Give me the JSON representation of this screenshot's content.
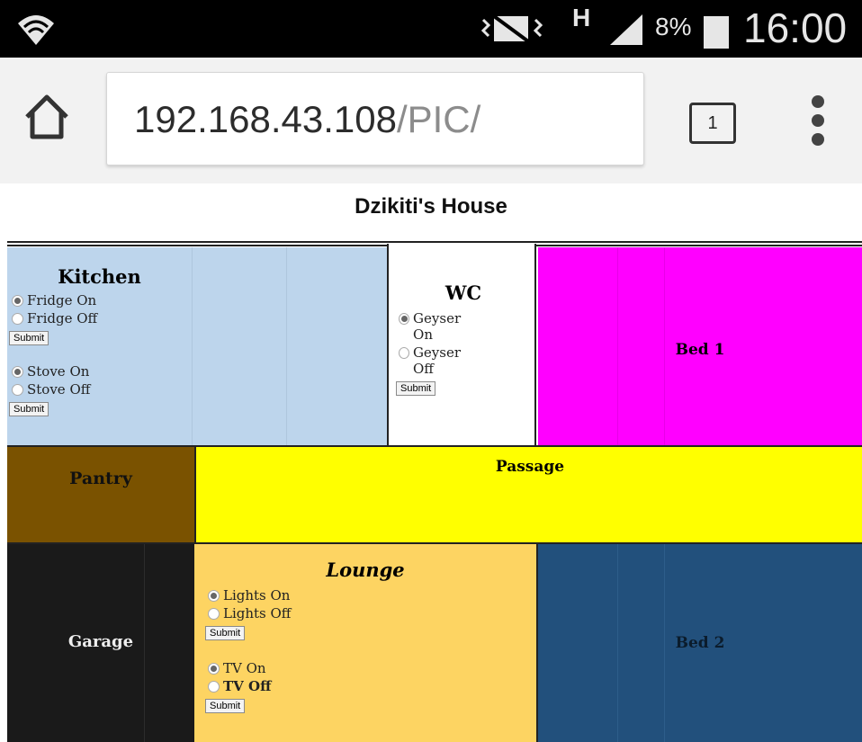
{
  "status_bar": {
    "h_indicator": "H",
    "battery_percent": "8%",
    "time": "16:00",
    "icons": [
      "wifi-icon",
      "mute-vibrate-icon",
      "data-transfer-icon",
      "signal-icon",
      "battery-icon"
    ]
  },
  "browser": {
    "url_host": "192.168.43.108",
    "url_path": "/PIC/",
    "tab_count": "1",
    "icons": [
      "home-icon",
      "tabs-icon",
      "overflow-menu-icon"
    ]
  },
  "page": {
    "title": "Dzikiti's House",
    "rooms": {
      "kitchen": {
        "name": "Kitchen",
        "color": "#bdd5ec",
        "fridge_on": "Fridge On",
        "fridge_off": "Fridge Off",
        "stove_on": "Stove On",
        "stove_off": "Stove Off",
        "submit": "Submit"
      },
      "wc": {
        "name": "WC",
        "color": "#ffffff",
        "geyser_on": "Geyser On",
        "geyser_off": "Geyser Off",
        "submit": "Submit"
      },
      "bed1": {
        "name": "Bed 1",
        "color": "#ff00ff"
      },
      "pantry": {
        "name": "Pantry",
        "color": "#7a5200"
      },
      "passage": {
        "name": "Passage",
        "color": "#ffff00"
      },
      "garage": {
        "name": "Garage",
        "color": "#1a1a1a"
      },
      "lounge": {
        "name": "Lounge",
        "color": "#fdd462",
        "lights_on": "Lights On",
        "lights_off": "Lights Off",
        "tv_on": "TV On",
        "tv_off": "TV Off",
        "submit": "Submit"
      },
      "bed2": {
        "name": "Bed 2",
        "color": "#22507c"
      }
    }
  }
}
